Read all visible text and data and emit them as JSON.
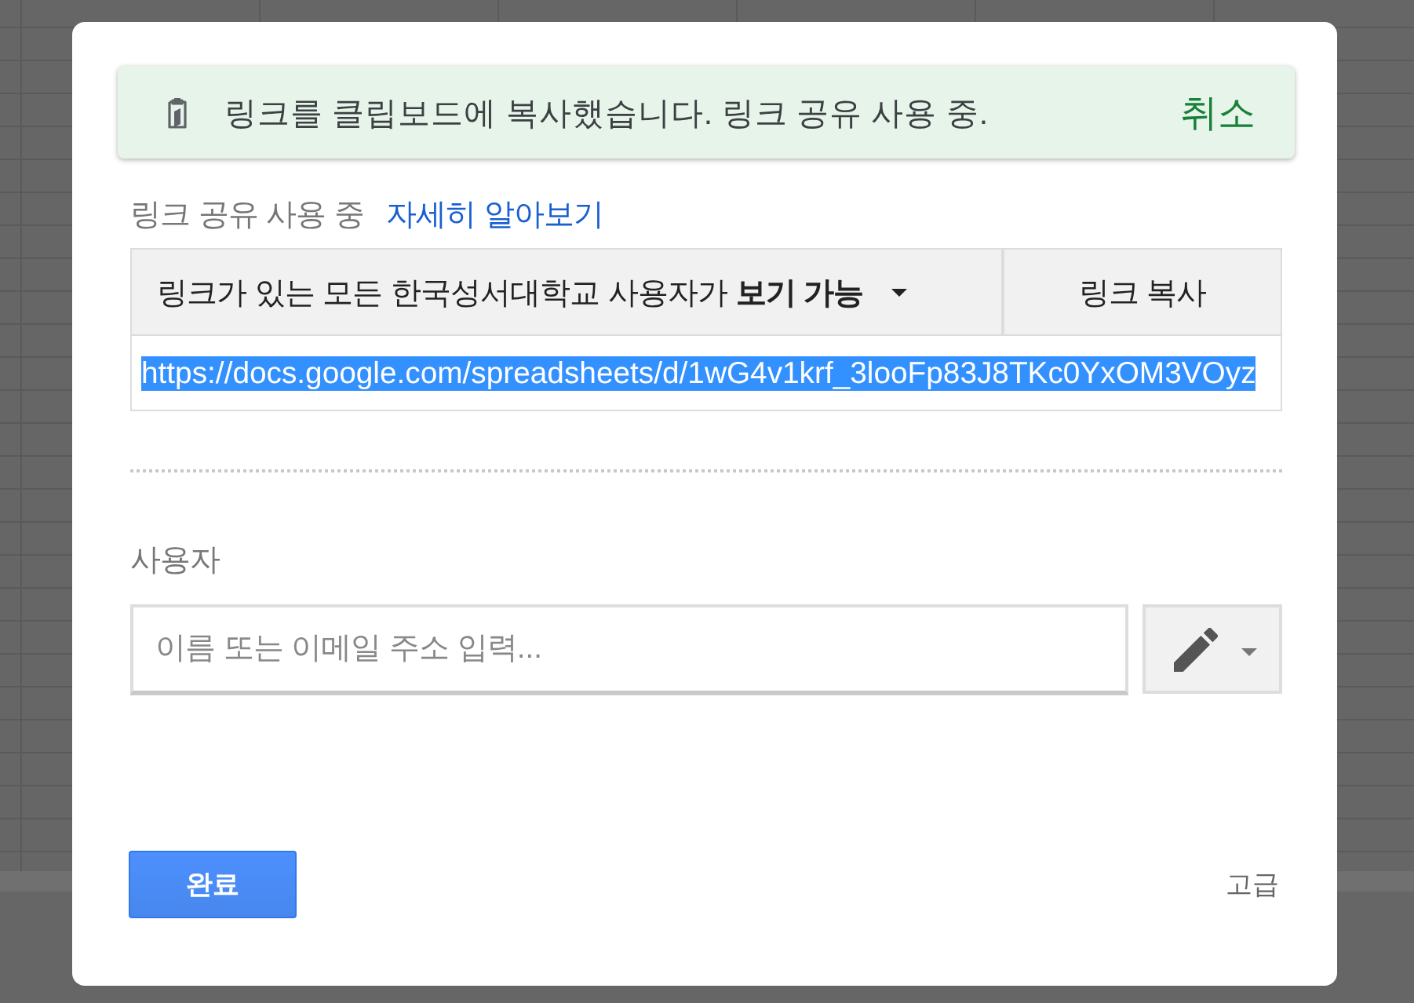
{
  "toast": {
    "message": "링크를 클립보드에 복사했습니다. 링크 공유 사용 중.",
    "action": "취소"
  },
  "link_sharing": {
    "status": "링크 공유 사용 중",
    "learn_more": "자세히 알아보기",
    "access": "링크가 있는 모든 한국성서대학교 사용자가 **보기 가능**",
    "copy_button": "링크 복사",
    "url": {
      "value": "https://docs.google.com/spreadsheets/d/1wG4v1krf_3looFp83J8TKc0YxOM3VOyz",
      "selected": true
    }
  },
  "people": {
    "label": "사용자",
    "input": {
      "placeholder": "이름 또는 이메일 주소 입력..."
    }
  },
  "footer": {
    "done_button": "완료",
    "advanced": "고급"
  }
}
